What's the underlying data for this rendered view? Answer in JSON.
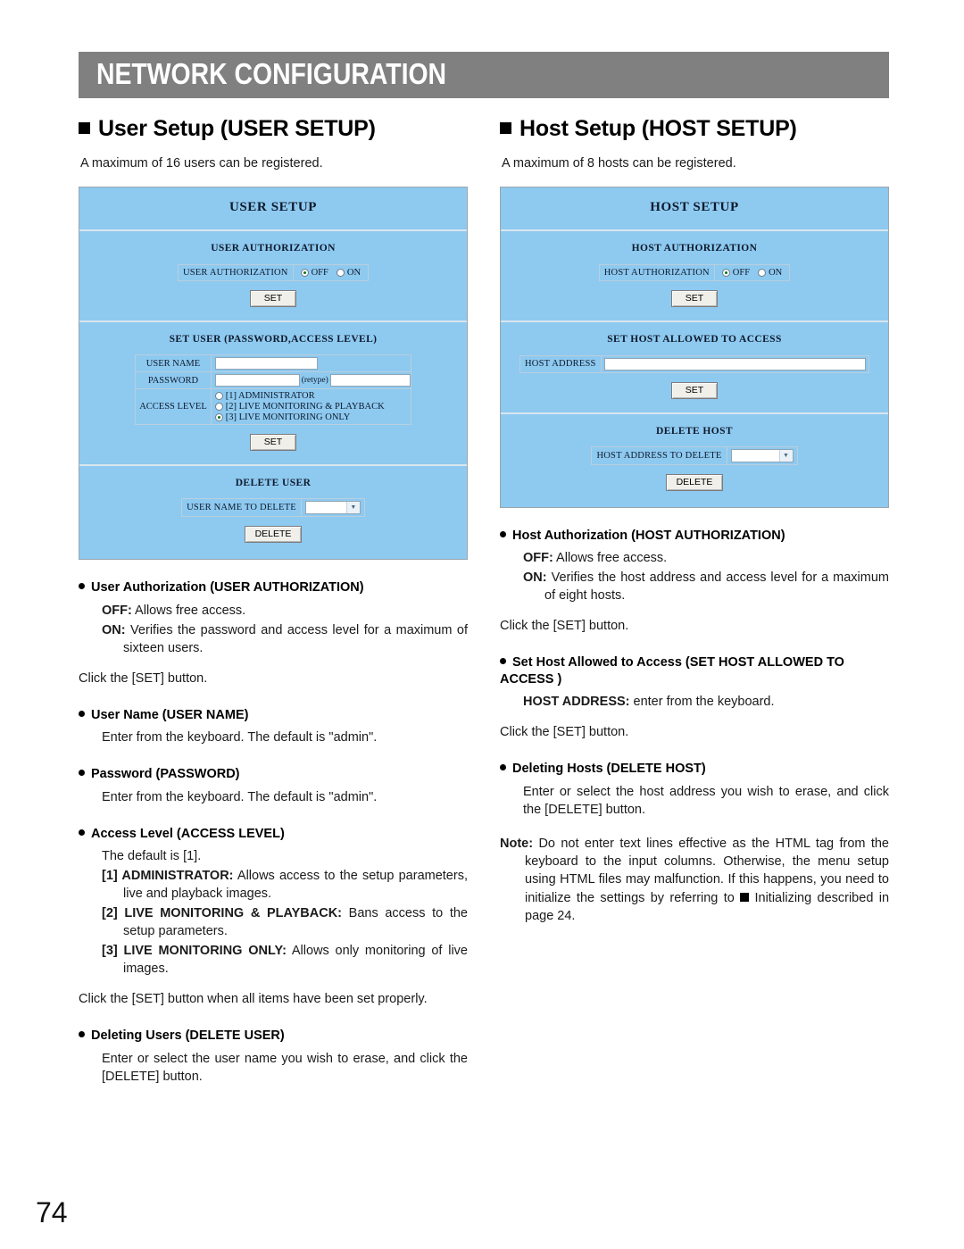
{
  "chapter": {
    "title": "NETWORK CONFIGURATION"
  },
  "page_number": "74",
  "left_column": {
    "heading": "User Setup (USER SETUP)",
    "intro": "A maximum of 16 users can be registered.",
    "panel": {
      "title": "USER SETUP",
      "auth_block": {
        "title": "USER AUTHORIZATION",
        "field_label": "USER AUTHORIZATION",
        "options": [
          {
            "label": "OFF",
            "selected": true
          },
          {
            "label": "ON",
            "selected": false
          }
        ],
        "set_button": "SET"
      },
      "set_user_block": {
        "title": "SET USER (PASSWORD,ACCESS LEVEL)",
        "user_name_label": "USER NAME",
        "user_name_value": "",
        "password_label": "PASSWORD",
        "password_value": "",
        "retype_label": "(retype)",
        "retype_value": "",
        "access_level_label": "ACCESS LEVEL",
        "access_levels": [
          {
            "label": "[1] ADMINISTRATOR",
            "selected": false
          },
          {
            "label": "[2] LIVE MONITORING & PLAYBACK",
            "selected": false
          },
          {
            "label": "[3] LIVE MONITORING ONLY",
            "selected": true
          }
        ],
        "set_button": "SET"
      },
      "delete_user_block": {
        "title": "DELETE USER",
        "field_label": "USER NAME TO DELETE",
        "selected_value": "",
        "delete_button": "DELETE"
      }
    },
    "sections": [
      {
        "heading": "User Authorization (USER AUTHORIZATION)",
        "lines": [
          {
            "term": "OFF:",
            "text": " Allows free access."
          },
          {
            "term": "ON:",
            "text": " Verifies the password and access level for a maximum of sixteen users."
          }
        ],
        "after": "Click the [SET] button."
      },
      {
        "heading": "User Name (USER NAME)",
        "body": "Enter from the keyboard. The default is \"admin\"."
      },
      {
        "heading": "Password (PASSWORD)",
        "body": "Enter from the keyboard. The default is \"admin\"."
      },
      {
        "heading": "Access Level (ACCESS LEVEL)",
        "default_line": "The default is [1].",
        "levels": [
          {
            "term": "[1] ADMINISTRATOR:",
            "text": " Allows access to the setup parameters, live and playback images."
          },
          {
            "term": "[2] LIVE MONITORING & PLAYBACK:",
            "text": " Bans access to the setup parameters."
          },
          {
            "term": "[3] LIVE MONITORING ONLY:",
            "text": " Allows only monitoring of live images."
          }
        ],
        "after": "Click the [SET] button when all items have been set properly."
      },
      {
        "heading": "Deleting Users (DELETE USER)",
        "body": "Enter or select the user name you wish to erase, and click the [DELETE] button."
      }
    ]
  },
  "right_column": {
    "heading": "Host Setup (HOST SETUP)",
    "intro": "A maximum of 8 hosts can be registered.",
    "panel": {
      "title": "HOST SETUP",
      "auth_block": {
        "title": "HOST AUTHORIZATION",
        "field_label": "HOST AUTHORIZATION",
        "options": [
          {
            "label": "OFF",
            "selected": true
          },
          {
            "label": "ON",
            "selected": false
          }
        ],
        "set_button": "SET"
      },
      "set_host_block": {
        "title": "SET HOST ALLOWED TO ACCESS",
        "field_label": "HOST ADDRESS",
        "field_value": "",
        "set_button": "SET"
      },
      "delete_host_block": {
        "title": "DELETE HOST",
        "field_label": "HOST ADDRESS TO DELETE",
        "selected_value": "",
        "delete_button": "DELETE"
      }
    },
    "sections": [
      {
        "heading": "Host Authorization (HOST AUTHORIZATION)",
        "lines": [
          {
            "term": "OFF:",
            "text": " Allows free access."
          },
          {
            "term": "ON:",
            "text": " Verifies the host address and access level for a maximum of eight hosts."
          }
        ],
        "after": "Click the [SET] button."
      },
      {
        "heading": "Set Host Allowed to Access (SET HOST ALLOWED TO ACCESS )",
        "term_line": {
          "term": "HOST ADDRESS:",
          "text": " enter from the keyboard."
        },
        "after": "Click the [SET] button."
      },
      {
        "heading": "Deleting Hosts (DELETE HOST)",
        "body": "Enter or select the host address you wish to erase, and click the [DELETE] button."
      }
    ],
    "note": {
      "term": "Note:",
      "text_before": " Do not enter text lines effective as the HTML tag from the keyboard to the input columns. Otherwise, the menu setup using HTML files may malfunction. If this happens, you need to initialize the settings by referring to ",
      "text_after": " Initializing described in page 24."
    }
  }
}
